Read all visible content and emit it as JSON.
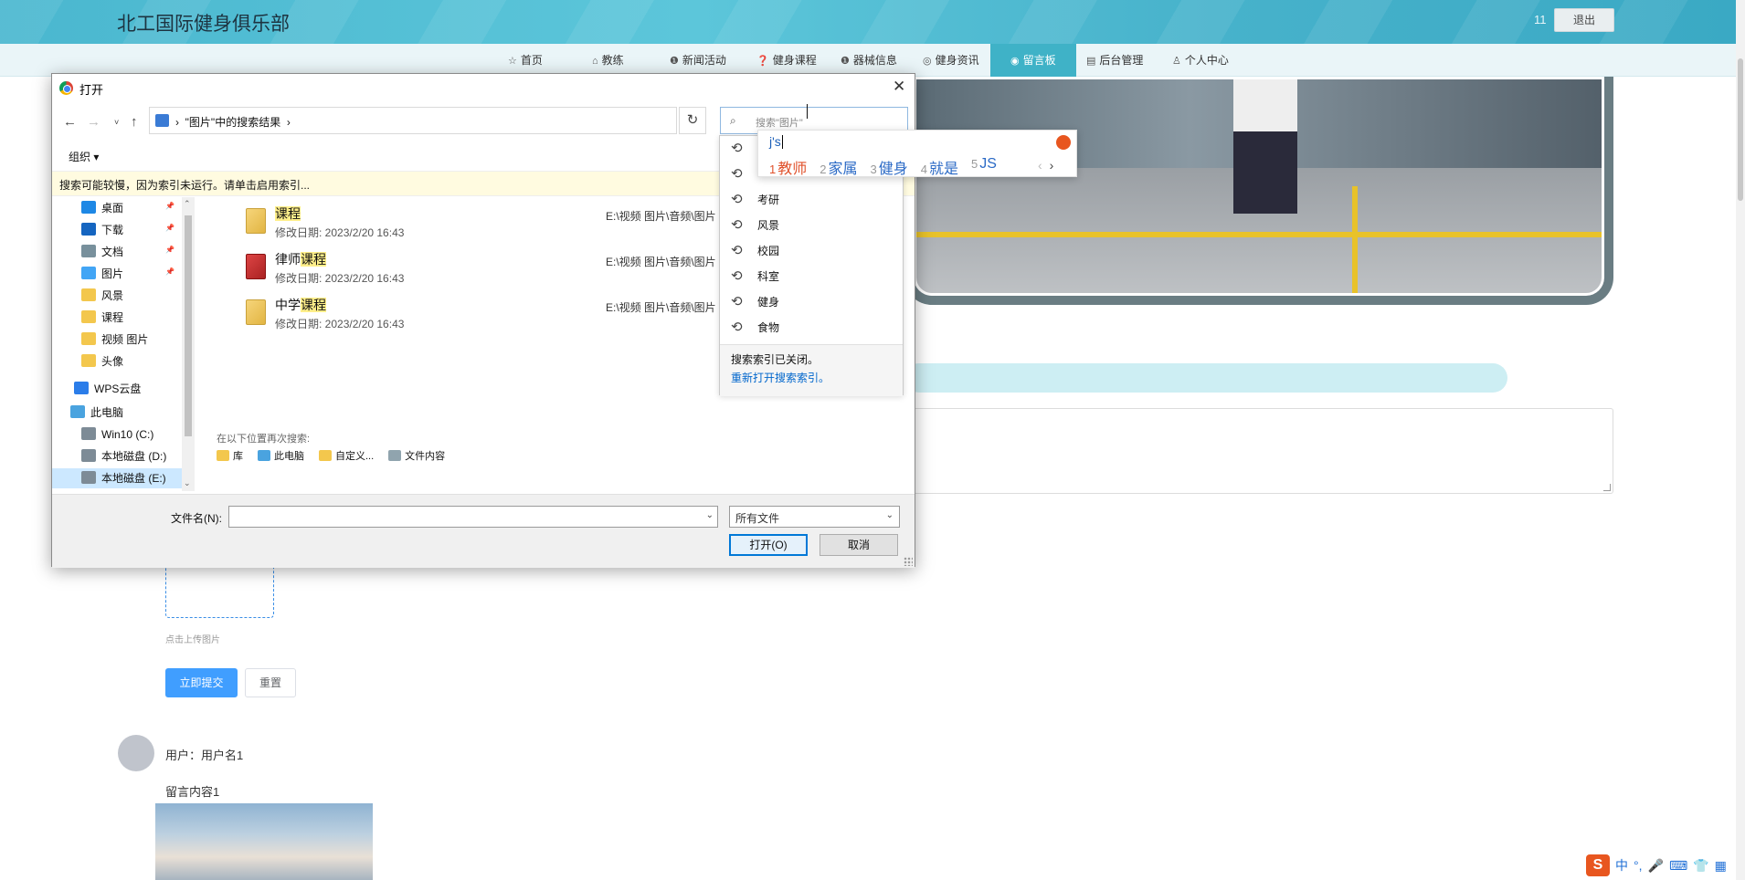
{
  "site": {
    "title": "北工国际健身俱乐部",
    "user_count": "11",
    "logout": "退出"
  },
  "nav": [
    {
      "label": "首页",
      "icon": "star-icon",
      "glyph": "☆"
    },
    {
      "label": "教练",
      "icon": "lock-icon",
      "glyph": "⌂"
    },
    {
      "label": "新闻活动",
      "icon": "info-icon",
      "glyph": "❶"
    },
    {
      "label": "健身课程",
      "icon": "question-icon",
      "glyph": "❓"
    },
    {
      "label": "器械信息",
      "icon": "info-icon",
      "glyph": "❶"
    },
    {
      "label": "健身资讯",
      "icon": "globe-icon",
      "glyph": "◎"
    },
    {
      "label": "留言板",
      "icon": "message-icon",
      "glyph": "◉",
      "active": true
    },
    {
      "label": "后台管理",
      "icon": "document-icon",
      "glyph": "▤"
    },
    {
      "label": "个人中心",
      "icon": "user-icon",
      "glyph": "♙"
    }
  ],
  "form": {
    "upload_hint": "点击上传图片",
    "submit": "立即提交",
    "reset": "重置"
  },
  "message": {
    "user": "用户：用户名1",
    "content": "留言内容1"
  },
  "dialog": {
    "title": "打开",
    "address": "\"图片\"中的搜索结果",
    "search_placeholder": "搜索\"图片\"",
    "organize": "组织 ▾",
    "info_bar": "搜索可能较慢，因为索引未运行。请单击启用索引...",
    "tree": [
      {
        "label": "桌面",
        "icon": "desktop-icon",
        "pinned": true
      },
      {
        "label": "下载",
        "icon": "download-icon",
        "pinned": true
      },
      {
        "label": "文档",
        "icon": "documents-icon",
        "pinned": true
      },
      {
        "label": "图片",
        "icon": "pictures-icon",
        "pinned": true
      },
      {
        "label": "风景",
        "icon": "folder-icon"
      },
      {
        "label": "课程",
        "icon": "folder-icon"
      },
      {
        "label": "视频 图片",
        "icon": "folder-icon"
      },
      {
        "label": "头像",
        "icon": "folder-icon"
      },
      {
        "label": "WPS云盘",
        "icon": "cloud-icon"
      },
      {
        "label": "此电脑",
        "icon": "computer-icon"
      },
      {
        "label": "Win10 (C:)",
        "icon": "drive-icon"
      },
      {
        "label": "本地磁盘 (D:)",
        "icon": "drive-icon"
      },
      {
        "label": "本地磁盘 (E:)",
        "icon": "drive-icon",
        "selected": true
      }
    ],
    "files": [
      {
        "prefix": "",
        "highlight": "课程",
        "date": "修改日期: 2023/2/20 16:43",
        "path": "E:\\视频 图片\\音频\\图片"
      },
      {
        "prefix": "律师",
        "highlight": "课程",
        "date": "修改日期: 2023/2/20 16:43",
        "path": "E:\\视频 图片\\音频\\图片"
      },
      {
        "prefix": "中学",
        "highlight": "课程",
        "date": "修改日期: 2023/2/20 16:43",
        "path": "E:\\视频 图片\\音频\\图片"
      }
    ],
    "re_search_label": "在以下位置再次搜索:",
    "re_search": [
      "库",
      "此电脑",
      "自定义...",
      "文件内容"
    ],
    "filename_label": "文件名(N):",
    "filetype": "所有文件",
    "open": "打开(O)",
    "cancel": "取消"
  },
  "history": {
    "items": [
      "",
      "",
      "考研",
      "风景",
      "校园",
      "科室",
      "健身",
      "食物"
    ],
    "note": "搜索索引已关闭。",
    "link": "重新打开搜索索引。"
  },
  "ime": {
    "input": "j's",
    "candidates": [
      "教师",
      "家属",
      "健身",
      "就是",
      "JS"
    ],
    "tray": [
      "S",
      "中",
      "°,",
      "🎤",
      "⌨",
      "👕",
      "▦"
    ]
  }
}
